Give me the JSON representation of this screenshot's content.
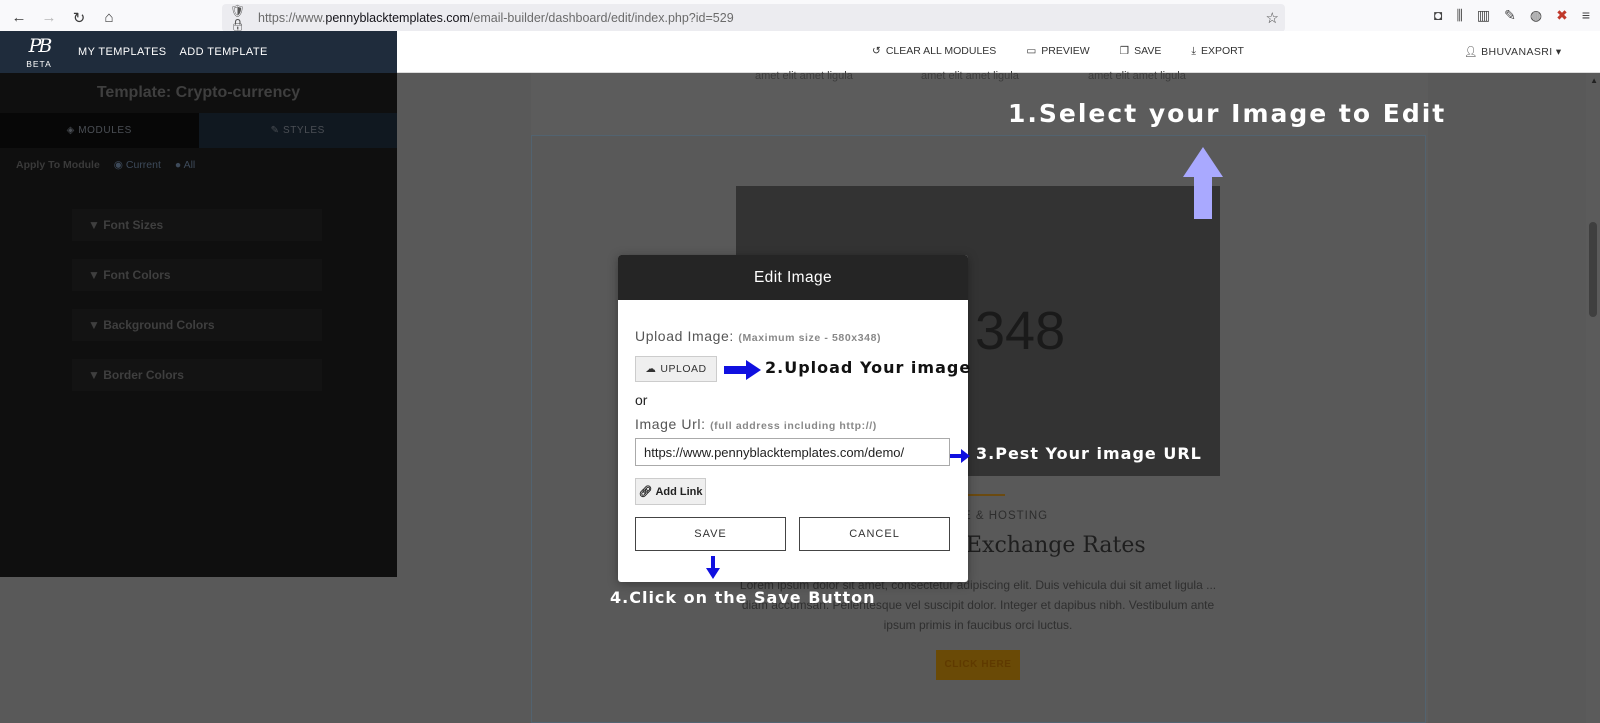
{
  "browser": {
    "url_prefix": "https://www.",
    "url_domain": "pennyblacktemplates.com",
    "url_path": "/email-builder/dashboard/edit/index.php?id=529"
  },
  "app": {
    "logo_text": "PB",
    "beta_label": "BETA",
    "nav_left": [
      "MY TEMPLATES",
      "ADD TEMPLATE"
    ],
    "nav_right": [
      {
        "label": "CLEAR ALL MODULES",
        "icon": "refresh-icon"
      },
      {
        "label": "PREVIEW",
        "icon": "monitor-icon"
      },
      {
        "label": "SAVE",
        "icon": "copy-icon"
      },
      {
        "label": "EXPORT",
        "icon": "download-icon"
      }
    ],
    "user_name": "BHUVANASRI"
  },
  "sidebar": {
    "template_title": "Template:  Crypto-currency",
    "tabs": [
      {
        "label": "MODULES",
        "icon": "cubes-icon"
      },
      {
        "label": "STYLES",
        "icon": "pencil-icon"
      }
    ],
    "apply_label": "Apply To Module",
    "apply_options": [
      "Current",
      "All"
    ],
    "sections": [
      "Font Sizes",
      "Font Colors",
      "Background Colors",
      "Border Colors"
    ]
  },
  "email": {
    "col_text": "amet elit amet ligula",
    "placeholder_size": "x 348",
    "kicker": "E & HOSTING",
    "heading": "Exchange Rates",
    "paragraph": "Lorem ipsum dolor sit amet, consectetur adipiscing elit. Duis vehicula dui sit amet ligula ... diam accumsan. Pellentesque vel suscipit dolor. Integer et dapibus nibh. Vestibulum ante ipsum primis in faucibus orci luctus.",
    "cta": "CLICK HERE"
  },
  "modal": {
    "title": "Edit Image",
    "upload_label": "Upload Image:",
    "upload_hint": "(Maximum size - 580x348)",
    "upload_button": "UPLOAD",
    "or_text": "or",
    "url_label": "Image Url:",
    "url_hint": "(full address including http://)",
    "url_value": "https://www.pennyblacktemplates.com/demo/",
    "add_link": "Add Link",
    "save": "SAVE",
    "cancel": "CANCEL"
  },
  "annotations": {
    "step1": "1.Select your Image to Edit",
    "step2": "2.Upload Your image",
    "step3": "3.Pest Your image URL",
    "step4": "4.Click on the Save Button"
  },
  "colors": {
    "header_dark": "#1f2c3c",
    "arrow_blue": "#1010e0",
    "arrow_light": "#a9a9ff"
  }
}
